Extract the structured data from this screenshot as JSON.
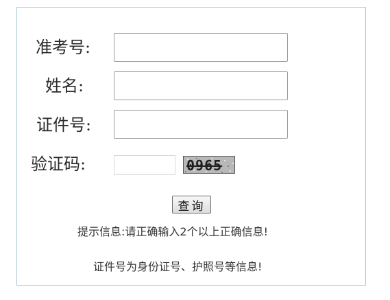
{
  "form": {
    "exam_number_label": "准考号:",
    "exam_number_value": "",
    "name_label": "姓名:",
    "name_value": "",
    "id_number_label": "证件号:",
    "id_number_value": "",
    "captcha_label": "验证码:",
    "captcha_value": "",
    "captcha_image_text": "0965",
    "search_button_label": "查询"
  },
  "hints": {
    "line1": "提示信息:请正确输入2个以上正确信息!",
    "line2": "证件号为身份证号、护照号等信息!"
  },
  "colors": {
    "panel_border": "#a9c6d6",
    "captcha_bg": "#b8b8b8"
  }
}
